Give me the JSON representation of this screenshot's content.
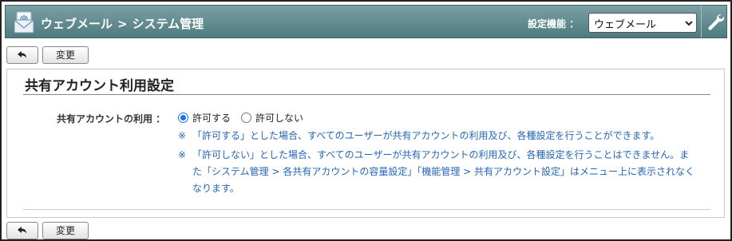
{
  "header": {
    "app_name": "ウェブメール",
    "breadcrumb_sep": ">",
    "page_name": "システム管理",
    "setting_label": "設定機能 ：",
    "setting_select_value": "ウェブメール"
  },
  "toolbar": {
    "change_label": "変更"
  },
  "panel": {
    "title": "共有アカウント利用設定",
    "field_label": "共有アカウントの利用 ：",
    "options": [
      {
        "label": "許可する",
        "checked": true
      },
      {
        "label": "許可しない",
        "checked": false
      }
    ],
    "notes": [
      {
        "mark": "※",
        "text": "「許可する」とした場合、すべてのユーザーが共有アカウントの利用及び、各種設定を行うことができます。"
      },
      {
        "mark": "※",
        "text": "「許可しない」とした場合、すべてのユーザーが共有アカウントの利用及び、各種設定を行うことはできません。また「システム管理 > 各共有アカウントの容量設定」「機能管理 > 共有アカウント設定」はメニュー上に表示されなくなります。"
      }
    ]
  },
  "icons": {
    "app": "webmail-envelope-icon",
    "back": "back-arrow-icon",
    "settings": "wrench-icon",
    "dropdown": "chevron-down-icon"
  },
  "colors": {
    "header_top": "#7aa0a4",
    "header_bottom": "#4e7b80",
    "note_text": "#2466b8",
    "radio_accent": "#1a73e8"
  }
}
